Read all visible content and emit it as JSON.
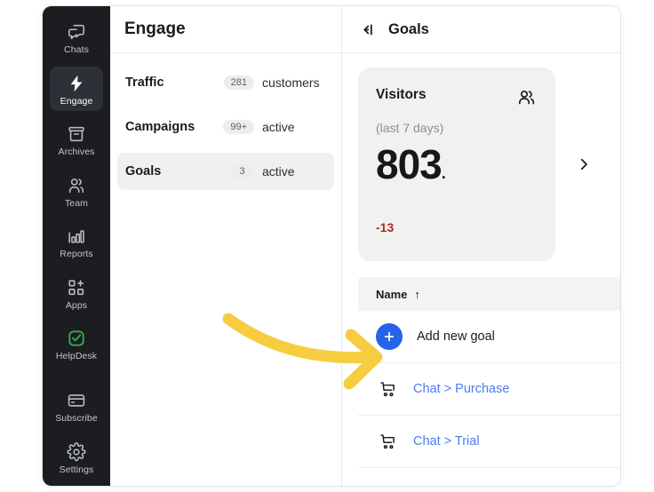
{
  "rail": {
    "items": [
      {
        "label": "Chats",
        "icon": "chats-icon",
        "active": false
      },
      {
        "label": "Engage",
        "icon": "bolt-icon",
        "active": true
      },
      {
        "label": "Archives",
        "icon": "archive-icon",
        "active": false
      },
      {
        "label": "Team",
        "icon": "team-icon",
        "active": false
      },
      {
        "label": "Reports",
        "icon": "reports-icon",
        "active": false
      },
      {
        "label": "Apps",
        "icon": "apps-icon",
        "active": false
      },
      {
        "label": "HelpDesk",
        "icon": "helpdesk-icon",
        "active": false
      }
    ],
    "bottom_items": [
      {
        "label": "Subscribe",
        "icon": "card-icon"
      },
      {
        "label": "Settings",
        "icon": "gear-icon"
      }
    ]
  },
  "middle": {
    "title": "Engage",
    "rows": [
      {
        "name": "Traffic",
        "count": "281",
        "unit": "customers",
        "selected": false
      },
      {
        "name": "Campaigns",
        "count": "99+",
        "unit": "active",
        "selected": false
      },
      {
        "name": "Goals",
        "count": "3",
        "unit": "active",
        "selected": true
      }
    ]
  },
  "right": {
    "collapse_icon": "collapse-panel-icon",
    "title": "Goals",
    "card": {
      "name": "Visitors",
      "subtitle": "(last 7 days)",
      "value": "803",
      "value_suffix": ".",
      "delta": "-13",
      "icon": "people-icon",
      "next_icon": "chevron-right-icon"
    },
    "table": {
      "header": {
        "label": "Name",
        "sort_icon": "↑"
      },
      "rows": [
        {
          "type": "action",
          "icon": "plus-icon",
          "label": "Add new goal"
        },
        {
          "type": "link",
          "icon": "cart-icon",
          "label": "Chat > Purchase"
        },
        {
          "type": "link",
          "icon": "cart-icon",
          "label": "Chat > Trial"
        }
      ]
    }
  },
  "annotation": {
    "type": "curved-arrow",
    "color": "#f5cd3f",
    "points_to": "add-new-goal-plus-button"
  },
  "colors": {
    "rail_bg": "#1b1d21",
    "accent_blue": "#2563eb",
    "link_blue": "#4b7cf3",
    "helpdesk_green": "#3fa34d",
    "negative_red": "#b3261e",
    "card_bg": "#f1f1f2",
    "annotation_yellow": "#f5cd3f"
  }
}
